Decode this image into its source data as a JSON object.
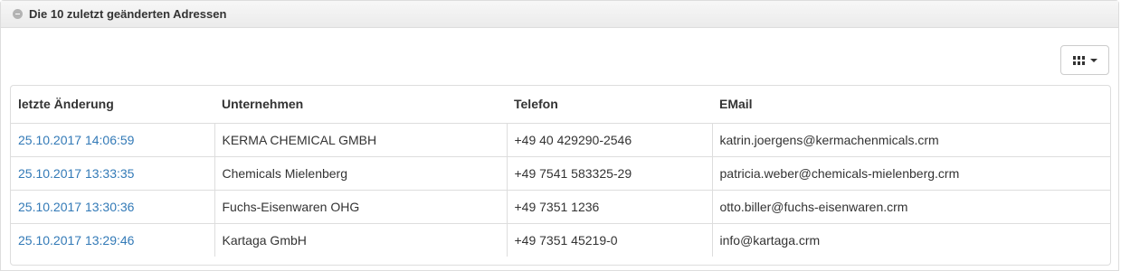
{
  "panel": {
    "title": "Die 10 zuletzt geänderten Adressen",
    "collapse_icon": "minus-circle-icon"
  },
  "toolbar": {
    "columns_icon": "grid-icon",
    "dropdown_icon": "caret-down-icon"
  },
  "table": {
    "headers": [
      "letzte Änderung",
      "Unternehmen",
      "Telefon",
      "EMail"
    ],
    "rows": [
      {
        "date": "25.10.2017 14:06:59",
        "company": "KERMA CHEMICAL GMBH",
        "phone": "+49 40 429290-2546",
        "email": "katrin.joergens@kermachenmicals.crm"
      },
      {
        "date": "25.10.2017 13:33:35",
        "company": "Chemicals Mielenberg",
        "phone": "+49 7541 583325-29",
        "email": "patricia.weber@chemicals-mielenberg.crm"
      },
      {
        "date": "25.10.2017 13:30:36",
        "company": "Fuchs-Eisenwaren OHG",
        "phone": "+49 7351 1236",
        "email": "otto.biller@fuchs-eisenwaren.crm"
      },
      {
        "date": "25.10.2017 13:29:46",
        "company": "Kartaga GmbH",
        "phone": "+49 7351 45219-0",
        "email": "info@kartaga.crm"
      }
    ]
  },
  "colors": {
    "link": "#337ab7",
    "border": "#dddddd",
    "text": "#333333"
  }
}
